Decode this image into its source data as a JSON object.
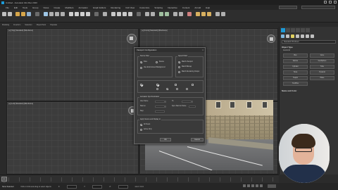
{
  "window": {
    "title": "Untitled - Autodesk 3ds Max 2020"
  },
  "menu": {
    "items": [
      "File",
      "Edit",
      "Tools",
      "Group",
      "Views",
      "Create",
      "Modifiers",
      "Animation",
      "Graph Editors",
      "Rendering",
      "Civil View",
      "Customize",
      "Scripting",
      "Interactive",
      "Content",
      "Arnold",
      "Help"
    ],
    "sign_in": "Sign In",
    "workspace": "Workspaces: Default"
  },
  "ribbon": {
    "items": [
      "Modeling",
      "Freeform",
      "Selection",
      "Object Paint",
      "Populate"
    ],
    "sub": "Polygon Modeling"
  },
  "viewports": {
    "top_label": "[+] [Top] [Standard] [Wireframe]",
    "front_label": "[+] [Front] [Standard] [Wireframe]",
    "left_label": "[+] [Left] [Standard] [Wireframe]",
    "persp_label": "[+] [Perspective] [Standard] [Default Shading]"
  },
  "dialog": {
    "title": "Viewport Configuration",
    "source_group": "Source Files",
    "aspect_group": "Aspect Ratio",
    "source_options": [
      "Files",
      "Device",
      "Use Environment Background"
    ],
    "aspect_options": [
      "Match Viewport",
      "Match Bitmap",
      "Match Rendering Output"
    ],
    "animation_group": "Animation Synchronization",
    "anim_labels": [
      "Use Frame",
      "To",
      "Step",
      "Start at",
      "Sync Start to Frame"
    ],
    "apply_group": "Apply Source and Display to",
    "apply_options": [
      "All Views",
      "Active Only"
    ],
    "ok": "OK",
    "cancel": "Cancel"
  },
  "command_panel": {
    "dropdown": "Standard Primitives",
    "object_type": "Object Type",
    "autogrid": "AutoGrid",
    "objects": [
      "Box",
      "Cone",
      "Sphere",
      "GeoSphere",
      "Cylinder",
      "Tube",
      "Torus",
      "Pyramid",
      "Teapot",
      "Plane",
      "TextPlus"
    ],
    "name_color": "Name and Color"
  },
  "timeline": {
    "slider": "0 / 100"
  },
  "status": {
    "selected": "None Selected",
    "prompt": "Click or click-and-drag to select objects",
    "x_label": "X:",
    "y_label": "Y:",
    "z_label": "Z:",
    "grid": "Grid = 10.0",
    "add_time_tag": "Add Time Tag",
    "auto_key": "Auto Key",
    "selected_dropdown": "Selected"
  }
}
